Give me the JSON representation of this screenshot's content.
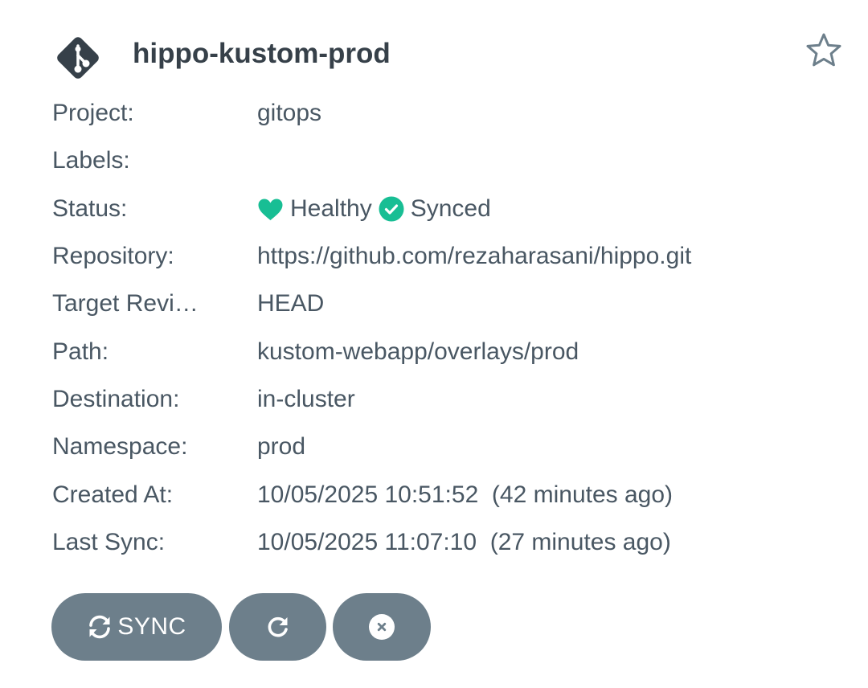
{
  "app": {
    "name": "hippo-kustom-prod",
    "icon": "git-icon",
    "favorite_icon": "star-outline-icon"
  },
  "fields": {
    "project": {
      "key": "Project:",
      "value": "gitops"
    },
    "labels": {
      "key": "Labels:",
      "value": ""
    },
    "status": {
      "key": "Status:",
      "health": "Healthy",
      "health_icon": "heart-icon",
      "sync": "Synced",
      "sync_icon": "check-circle-icon",
      "status_color": "#18be94"
    },
    "repository": {
      "key": "Repository:",
      "value": "https://github.com/rezaharasani/hippo.git"
    },
    "target_revision": {
      "key": "Target Revi…",
      "value": "HEAD"
    },
    "path": {
      "key": "Path:",
      "value": "kustom-webapp/overlays/prod"
    },
    "destination": {
      "key": "Destination:",
      "value": "in-cluster"
    },
    "namespace": {
      "key": "Namespace:",
      "value": "prod"
    },
    "created_at": {
      "key": "Created At:",
      "value": "10/05/2025 10:51:52  (42 minutes ago)"
    },
    "last_sync": {
      "key": "Last Sync:",
      "value": "10/05/2025 11:07:10  (27 minutes ago)"
    }
  },
  "actions": {
    "sync_label": "SYNC",
    "sync_icon": "sync-icon",
    "refresh_icon": "refresh-icon",
    "delete_icon": "close-circle-icon",
    "button_color": "#6d7f8b"
  }
}
